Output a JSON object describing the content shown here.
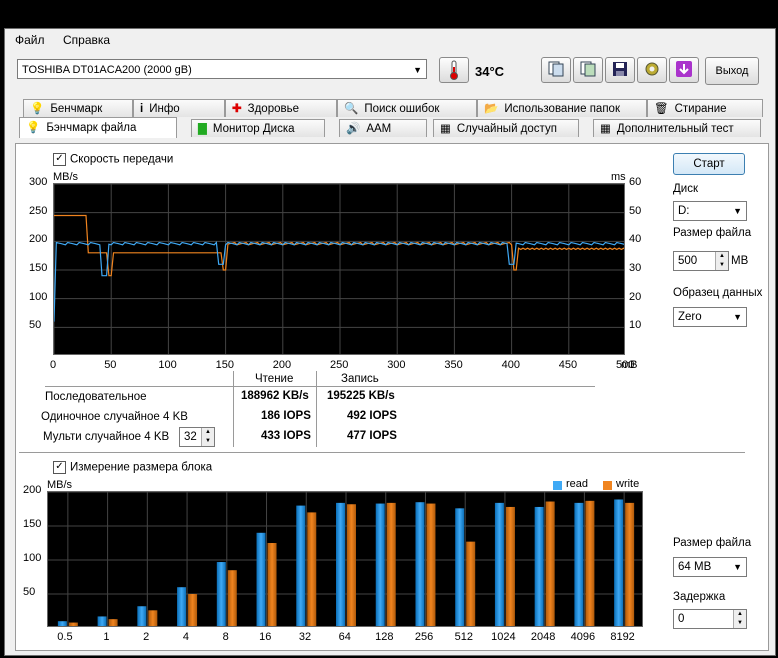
{
  "menu": {
    "file": "Файл",
    "help": "Справка"
  },
  "toolbar": {
    "drive": "TOSHIBA DT01ACA200 (2000 gB)",
    "temperature": "34°C",
    "exit_label": "Выход",
    "icons": [
      "copy-text-icon",
      "copy-image-icon",
      "save-icon",
      "options-icon",
      "download-icon"
    ]
  },
  "tabs_row1": [
    "Бенчмарк",
    "Инфо",
    "Здоровье",
    "Поиск ошибок",
    "Использование папок",
    "Стирание"
  ],
  "tabs_row2": [
    "Бэнчмарк файла",
    "Монитор Диска",
    "AAM",
    "Случайный доступ",
    "Дополнительный тест"
  ],
  "transfer": {
    "checkbox_label": "Скорость передачи",
    "unit_left": "MB/s",
    "unit_right": "ms",
    "x_unit": "mB",
    "y_ticks": [
      "300",
      "250",
      "200",
      "150",
      "100",
      "50"
    ],
    "ms_ticks": [
      "60",
      "50",
      "40",
      "30",
      "20",
      "10"
    ],
    "x_ticks": [
      "0",
      "50",
      "100",
      "150",
      "200",
      "250",
      "300",
      "350",
      "400",
      "450",
      "500"
    ],
    "read_color": "#3fa9f5",
    "write_color": "#f0841f"
  },
  "results": {
    "col_read": "Чтение",
    "col_write": "Запись",
    "rows": [
      {
        "label": "Последовательное",
        "read": "188962 KB/s",
        "write": "195225 KB/s"
      },
      {
        "label": "Одиночное случайное 4 KB",
        "read": "186 IOPS",
        "write": "492 IOPS"
      },
      {
        "label": "Мульти случайное 4 KB",
        "read": "433 IOPS",
        "write": "477 IOPS"
      }
    ],
    "queue_depth": "32"
  },
  "side": {
    "start_label": "Старт",
    "disk_label": "Диск",
    "disk_value": "D:",
    "filesize_label": "Размер файла",
    "filesize_value": "500",
    "filesize_unit": "MB",
    "pattern_label": "Образец данных",
    "pattern_value": "Zero"
  },
  "block": {
    "checkbox_label": "Измерение размера блока",
    "filesize_label": "Размер файла",
    "filesize_value": "64 MB",
    "delay_label": "Задержка",
    "delay_value": "0"
  },
  "chart_data": {
    "type": "bar",
    "ylabel": "MB/s",
    "ylim": [
      0,
      200
    ],
    "y_ticks": [
      "200",
      "150",
      "100",
      "50"
    ],
    "categories": [
      "0.5",
      "1",
      "2",
      "4",
      "8",
      "16",
      "32",
      "64",
      "128",
      "256",
      "512",
      "1024",
      "2048",
      "4096",
      "8192"
    ],
    "series": [
      {
        "name": "read",
        "color": "#3fa9f5",
        "values": [
          10,
          17,
          32,
          60,
          97,
          140,
          180,
          184,
          183,
          185,
          176,
          184,
          178,
          184,
          189
        ]
      },
      {
        "name": "write",
        "color": "#f0841f",
        "values": [
          8,
          13,
          26,
          50,
          85,
          125,
          170,
          182,
          184,
          183,
          127,
          178,
          186,
          187,
          184
        ]
      }
    ]
  }
}
